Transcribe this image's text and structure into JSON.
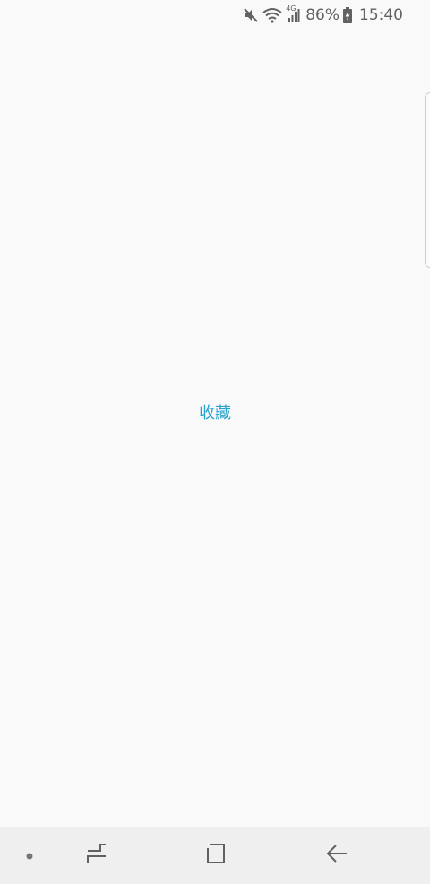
{
  "status_bar": {
    "icons": [
      "mute-icon",
      "wifi-icon",
      "4g-signal-icon",
      "battery-charging-icon"
    ],
    "network_type": "4G",
    "battery_percent": "86%",
    "time": "15:40"
  },
  "main": {
    "label": "收藏"
  },
  "nav_bar": {
    "buttons": [
      "nav-dot-icon",
      "recents-icon",
      "home-icon",
      "back-icon"
    ]
  }
}
